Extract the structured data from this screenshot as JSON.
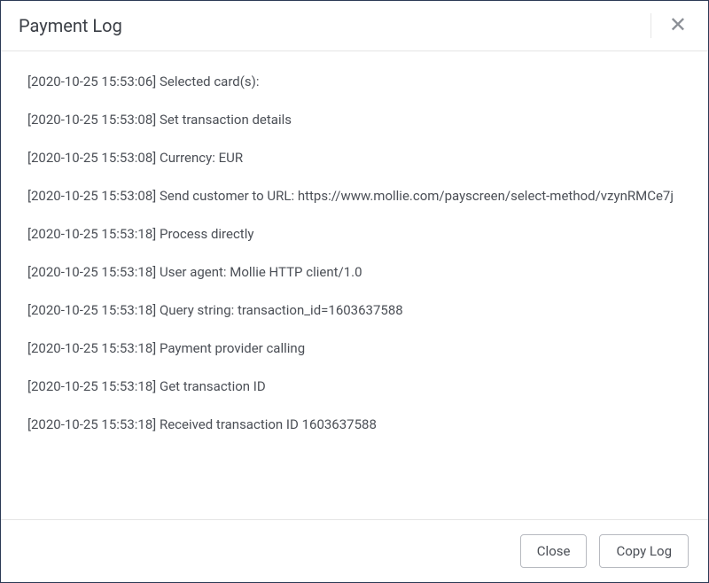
{
  "header": {
    "title": "Payment Log"
  },
  "log": {
    "entries": [
      {
        "ts": "2020-10-25 15:53:06",
        "msg": "Selected card(s):"
      },
      {
        "ts": "2020-10-25 15:53:08",
        "msg": "Set transaction details"
      },
      {
        "ts": "2020-10-25 15:53:08",
        "msg": "Currency: EUR"
      },
      {
        "ts": "2020-10-25 15:53:08",
        "msg": "Send customer to URL: https://www.mollie.com/payscreen/select-method/vzynRMCe7j"
      },
      {
        "ts": "2020-10-25 15:53:18",
        "msg": "Process directly"
      },
      {
        "ts": "2020-10-25 15:53:18",
        "msg": "User agent: Mollie HTTP client/1.0"
      },
      {
        "ts": "2020-10-25 15:53:18",
        "msg": "Query string: transaction_id=1603637588"
      },
      {
        "ts": "2020-10-25 15:53:18",
        "msg": "Payment provider calling"
      },
      {
        "ts": "2020-10-25 15:53:18",
        "msg": "Get transaction ID"
      },
      {
        "ts": "2020-10-25 15:53:18",
        "msg": "Received transaction ID 1603637588"
      }
    ]
  },
  "footer": {
    "close_label": "Close",
    "copy_label": "Copy Log"
  }
}
